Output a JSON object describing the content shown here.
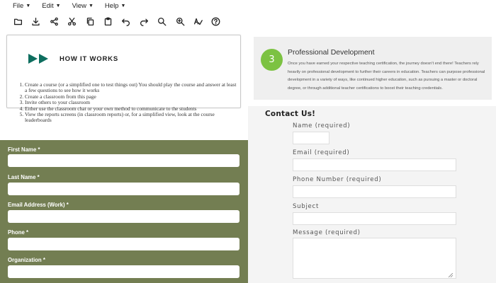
{
  "menu": {
    "items": [
      {
        "label": "File"
      },
      {
        "label": "Edit"
      },
      {
        "label": "View"
      },
      {
        "label": "Help"
      }
    ]
  },
  "toolbar": {
    "buttons": [
      "open-folder-icon",
      "download-icon",
      "share-icon",
      "scissors-icon",
      "copy-icon",
      "paste-icon",
      "undo-icon",
      "redo-icon",
      "zoom-out-icon",
      "zoom-in-icon",
      "spell-check-icon",
      "help-icon"
    ]
  },
  "how_it_works": {
    "title": "HOW IT WORKS",
    "accent_color": "#0e6e5f",
    "steps": [
      "Create a course (or a simplified one to test things out)   You should play the course and answer at least a few questions to see how it works",
      "Create a classroom from this page",
      "Invite others to your classroom",
      "Either use the classroom chat or your own method to communicate to the students",
      "View the reports screens (in classroom reports) or, for a simplified view, look at the course leaderboards"
    ]
  },
  "signup_form": {
    "background": "#737e52",
    "fields": [
      {
        "label": "First Name *",
        "value": ""
      },
      {
        "label": "Last Name *",
        "value": ""
      },
      {
        "label": "Email Address (Work) *",
        "value": ""
      },
      {
        "label": "Phone *",
        "value": ""
      },
      {
        "label": "Organization *",
        "value": ""
      }
    ]
  },
  "professional_development": {
    "badge": "3",
    "badge_color": "#7cc242",
    "title": "Professional Development",
    "body": "Once you have earned your respective teaching certification, the journey doesn't end there! Teachers rely heavily on professional development to further their careers in education. Teachers can purpose professional development in a variety of ways, like continued higher education, such as pursuing a master or doctoral degree, or through additional teacher certifications to boost their teaching credentials."
  },
  "contact": {
    "title": "Contact Us!",
    "fields": [
      {
        "label": "Name (required)",
        "value": ""
      },
      {
        "label": "Email (required)",
        "value": ""
      },
      {
        "label": "Phone Number (required)",
        "value": ""
      },
      {
        "label": "Subject",
        "value": ""
      },
      {
        "label": "Message (required)",
        "value": ""
      }
    ]
  }
}
